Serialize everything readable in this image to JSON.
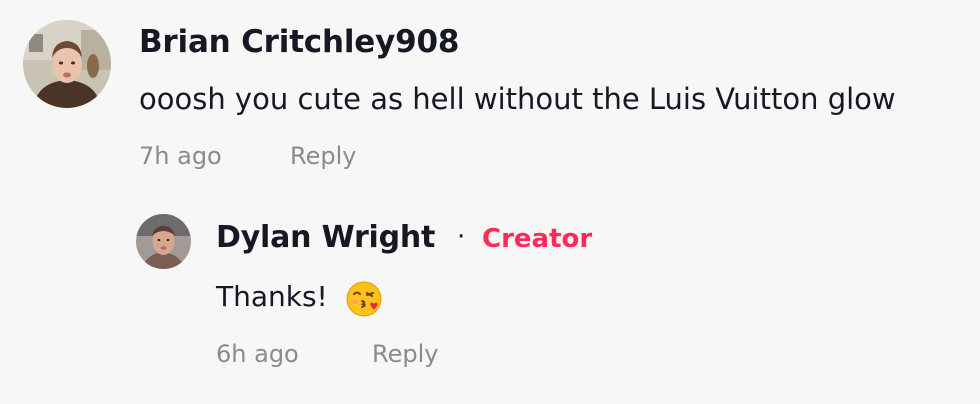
{
  "comment": {
    "author": "Brian Critchley908",
    "text": "ooosh you cute as hell without the Luis Vuitton glow",
    "time": "7h ago",
    "reply_label": "Reply"
  },
  "reply": {
    "author": "Dylan Wright",
    "separator": "·",
    "badge": "Creator",
    "text": "Thanks!",
    "emoji": "face-blowing-a-kiss-icon",
    "time": "6h ago",
    "reply_label": "Reply"
  },
  "colors": {
    "background": "#f7f7f7",
    "text_primary": "#161823",
    "text_secondary": "#8a8b91",
    "creator_badge": "#fe2c55"
  }
}
